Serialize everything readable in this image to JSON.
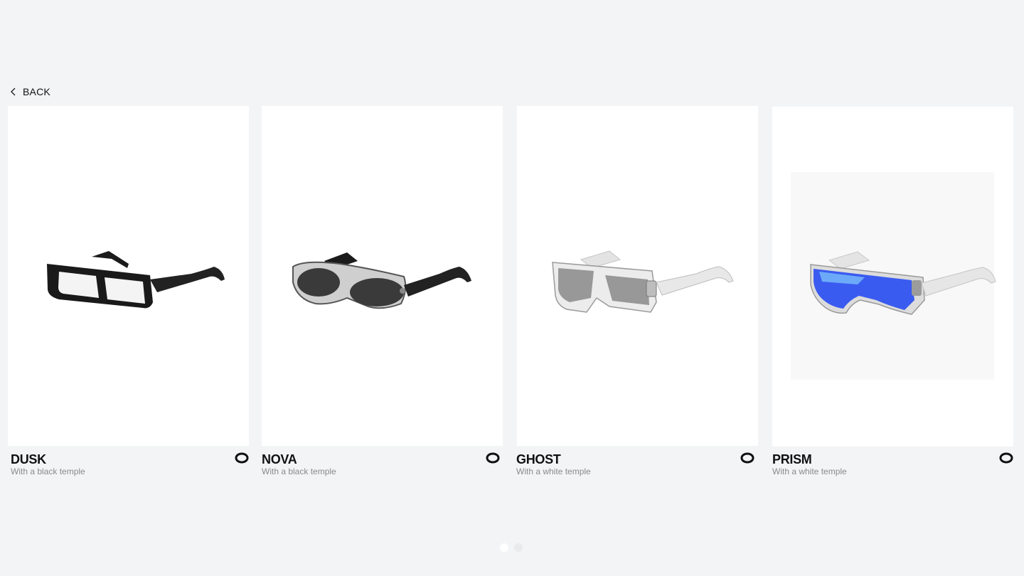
{
  "nav": {
    "back_label": "BACK"
  },
  "products": [
    {
      "name": "DUSK",
      "subtitle": "With a black temple",
      "icon": "brand-ring-icon"
    },
    {
      "name": "NOVA",
      "subtitle": "With a black temple",
      "icon": "brand-ring-icon"
    },
    {
      "name": "GHOST",
      "subtitle": "With a white temple",
      "icon": "brand-ring-icon"
    },
    {
      "name": "PRISM",
      "subtitle": "With a white temple",
      "icon": "brand-ring-icon"
    }
  ],
  "pagination": {
    "pages": 2,
    "active": 1
  },
  "colors": {
    "background": "#f3f4f6",
    "card": "#ffffff",
    "text": "#111111",
    "muted": "#8a8a8a",
    "lens_blue": "#3a5bf0"
  }
}
